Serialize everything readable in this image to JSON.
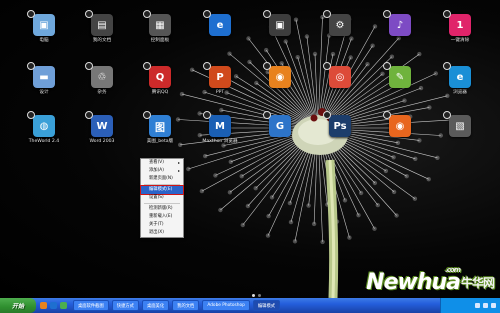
{
  "desktop": {
    "icons": [
      {
        "name": "computer-icon",
        "label": "电脑",
        "color": "#6fa8dc",
        "glyph": "▣"
      },
      {
        "name": "documents-icon",
        "label": "我的文档",
        "color": "#444",
        "glyph": "▤"
      },
      {
        "name": "control-panel-icon",
        "label": "控制面板",
        "color": "#555",
        "glyph": "▦"
      },
      {
        "name": "ie-icon",
        "label": "",
        "color": "#1e6fd0",
        "glyph": "e"
      },
      {
        "name": "app-icon-2",
        "label": "",
        "color": "#3d3d3d",
        "glyph": "▣"
      },
      {
        "name": "settings-icon",
        "label": "",
        "color": "#444",
        "glyph": "⚙"
      },
      {
        "name": "music-icon",
        "label": "",
        "color": "#7d4bc4",
        "glyph": "♪"
      },
      {
        "name": "one-key-icon",
        "label": "一键清除",
        "color": "#e0246a",
        "glyph": "1"
      },
      {
        "name": "folder-icon",
        "label": "设计",
        "color": "#6f9fd8",
        "glyph": "▬"
      },
      {
        "name": "recycle-icon",
        "label": "杂务",
        "color": "#777",
        "glyph": "♲"
      },
      {
        "name": "qq-icon",
        "label": "腾讯QQ",
        "color": "#cc2a2a",
        "glyph": "Q"
      },
      {
        "name": "ppt-icon",
        "label": "PPT",
        "color": "#d04a1c",
        "glyph": "P"
      },
      {
        "name": "firefox-icon-2",
        "label": "",
        "color": "#e8821e",
        "glyph": "◉"
      },
      {
        "name": "chrome-icon",
        "label": "",
        "color": "#dd4b39",
        "glyph": "◎"
      },
      {
        "name": "edit-icon",
        "label": "",
        "color": "#6fb33d",
        "glyph": "✎"
      },
      {
        "name": "browser-icon",
        "label": "浏览器",
        "color": "#1a8fd6",
        "glyph": "e"
      },
      {
        "name": "theworld-icon",
        "label": "TheWorld 2.4",
        "color": "#3aa0d8",
        "glyph": "◍"
      },
      {
        "name": "word-icon",
        "label": "Word 2003",
        "color": "#2b5fb8",
        "glyph": "W"
      },
      {
        "name": "picture-icon",
        "label": "美图_beta版",
        "color": "#2f7fd4",
        "glyph": "图"
      },
      {
        "name": "maxthon-icon",
        "label": "Maxthon 浏览器",
        "color": "#1a5fb4",
        "glyph": "M"
      },
      {
        "name": "g-icon",
        "label": "",
        "color": "#2d74c9",
        "glyph": "G"
      },
      {
        "name": "photoshop-icon",
        "label": "",
        "color": "#1c3d6b",
        "glyph": "Ps"
      },
      {
        "name": "firefox-icon",
        "label": "",
        "color": "#e8661e",
        "glyph": "◉"
      },
      {
        "name": "photo-icon",
        "label": "",
        "color": "#5a5a5a",
        "glyph": "▧"
      }
    ]
  },
  "context_menu": {
    "items": [
      {
        "label": "查看(V)",
        "arrow": true
      },
      {
        "label": "添加(A)",
        "arrow": true
      },
      {
        "label": "新建页面(N)",
        "arrow": false
      },
      {
        "label": "编辑模式(E)",
        "arrow": false,
        "selected": true
      },
      {
        "label": "设置(S)",
        "arrow": false
      },
      {
        "label": "检测新版(R)",
        "arrow": false
      },
      {
        "label": "重新载入(E)",
        "arrow": false
      },
      {
        "label": "关于(T)",
        "arrow": false
      },
      {
        "label": "退出(X)",
        "arrow": false
      }
    ]
  },
  "watermark": {
    "brand": "Newhua",
    "cn": "牛华网",
    "com": ".com"
  },
  "taskbar": {
    "start_label": "开始",
    "tasks": [
      {
        "label": "桌面软件截图",
        "active": false
      },
      {
        "label": "快捷方式",
        "active": false
      },
      {
        "label": "桌面美化",
        "active": false
      },
      {
        "label": "我的文档",
        "active": false
      },
      {
        "label": "Adobe Photoshop",
        "active": false
      },
      {
        "label": "编辑模式",
        "active": true
      }
    ],
    "quick_colors": [
      "#e8821e",
      "#1e6fd0",
      "#4caf50"
    ],
    "clock": ""
  },
  "colors": {
    "menu_highlight": "#2b63c8",
    "highlight_border": "#d01414",
    "taskbar": "#245edb"
  }
}
